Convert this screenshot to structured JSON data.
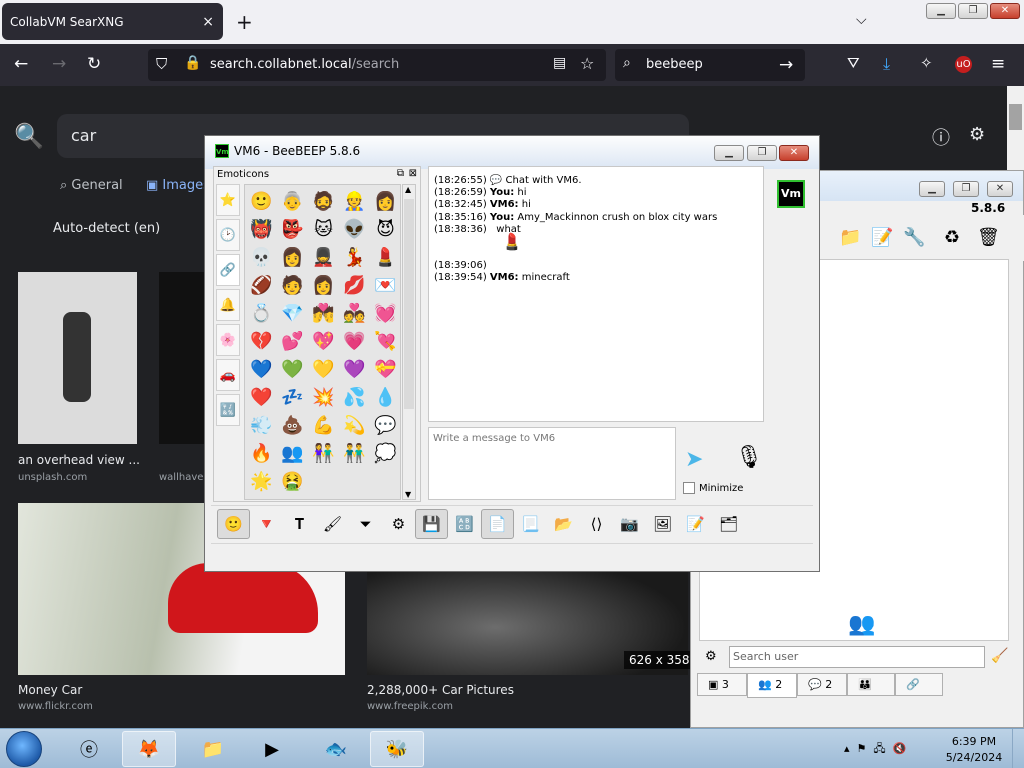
{
  "browser": {
    "tab_title": "CollabVM SearXNG",
    "tab_close": "×",
    "new_tab": "+",
    "url_host": "search.collabnet.local",
    "url_path": "/search",
    "search_query": "beebeep"
  },
  "page": {
    "query": "car",
    "categories": [
      "General",
      "Images"
    ],
    "lang": "Auto-detect (en)",
    "results": [
      {
        "caption": "an overhead view ...",
        "source": "unsplash.com"
      },
      {
        "caption": "wallhaven",
        "source": ""
      },
      {
        "caption": "Money Car",
        "source": "www.flickr.com"
      },
      {
        "caption": "2,288,000+ Car Pictures",
        "source": "www.freepik.com"
      }
    ],
    "dimension_badge": "626 x 358"
  },
  "chat": {
    "title": "VM6 - BeeBEEP 5.8.6",
    "emoticons_label": "Emoticons",
    "avatar_text": "Vm",
    "messages": [
      {
        "time": "(18:26:55)",
        "sender": "",
        "text": "Chat with VM6."
      },
      {
        "time": "(18:26:59)",
        "sender": "You:",
        "text": "hi"
      },
      {
        "time": "(18:32:45)",
        "sender": "VM6:",
        "text": "hi"
      },
      {
        "time": "(18:35:16)",
        "sender": "You:",
        "text": "Amy_Mackinnon crush on blox city wars"
      },
      {
        "time": "(18:38:36)",
        "sender": "",
        "text": "what"
      },
      {
        "time": "(18:39:06)",
        "sender": "",
        "text": ""
      },
      {
        "time": "(18:39:54)",
        "sender": "VM6:",
        "text": "minecraft"
      }
    ],
    "compose_placeholder": "Write a message to VM6",
    "minimize_label": "Minimize",
    "emojis": [
      "🙂",
      "👵",
      "🧔",
      "👷",
      "👩",
      "👹",
      "👺",
      "🐱",
      "👽",
      "😈",
      "💀",
      "👩",
      "💂",
      "💃",
      "💄",
      "🏈",
      "🧑",
      "👩",
      "💋",
      "💌",
      "💍",
      "💎",
      "💏",
      "💑",
      "💓",
      "💔",
      "💕",
      "💖",
      "💗",
      "💘",
      "💙",
      "💚",
      "💛",
      "💜",
      "💝",
      "❤️",
      "💤",
      "💥",
      "💦",
      "💧",
      "💨",
      "💩",
      "💪",
      "💫",
      "💬",
      "🔥",
      "👥",
      "👫",
      "👬",
      "💭",
      "🌟",
      "🤮"
    ]
  },
  "bbmain": {
    "version": "5.8.6",
    "search_placeholder": "Search user",
    "tabs": [
      {
        "icon": "monitor-icon",
        "count": "3"
      },
      {
        "icon": "users-icon",
        "count": "2"
      },
      {
        "icon": "chat-icon",
        "count": "2"
      },
      {
        "icon": "group-icon",
        "count": ""
      },
      {
        "icon": "share-icon",
        "count": ""
      }
    ]
  },
  "taskbar": {
    "time": "6:39 PM",
    "date": "5/24/2024"
  }
}
